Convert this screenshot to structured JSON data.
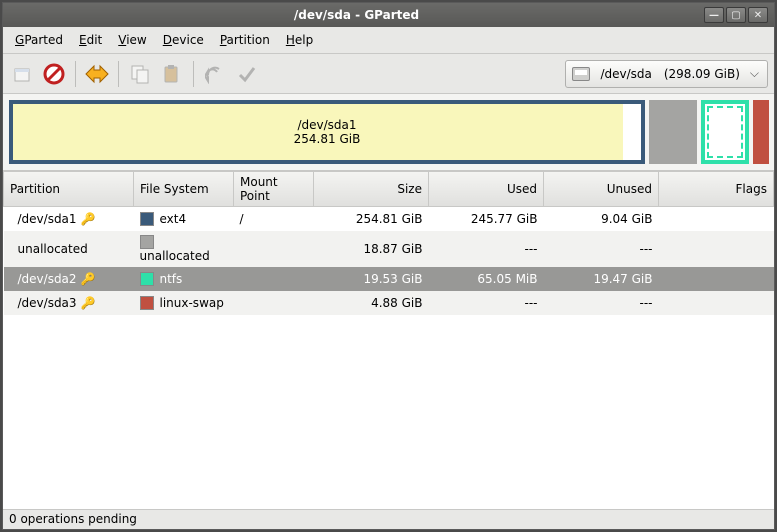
{
  "window": {
    "title": "/dev/sda - GParted"
  },
  "menubar": {
    "gparted": "GParted",
    "edit": "Edit",
    "view": "View",
    "device": "Device",
    "partition": "Partition",
    "help": "Help"
  },
  "toolbar": {
    "new": "New",
    "delete": "Delete",
    "resize": "Resize/Move",
    "copy": "Copy",
    "paste": "Paste",
    "undo": "Undo",
    "apply": "Apply"
  },
  "device": {
    "path": "/dev/sda",
    "size": "(298.09 GiB)"
  },
  "viz": {
    "main_label": "/dev/sda1",
    "main_size": "254.81 GiB"
  },
  "columns": {
    "partition": "Partition",
    "filesystem": "File System",
    "mountpoint": "Mount Point",
    "size": "Size",
    "used": "Used",
    "unused": "Unused",
    "flags": "Flags"
  },
  "rows": [
    {
      "name": "/dev/sda1",
      "locked": true,
      "fs": "ext4",
      "fs_color": "#3a5a7a",
      "mount": "/",
      "size": "254.81 GiB",
      "used": "245.77 GiB",
      "unused": "9.04 GiB",
      "flags": "",
      "selected": false,
      "striped": false
    },
    {
      "name": "unallocated",
      "locked": false,
      "fs": "unallocated",
      "fs_color": "#a4a4a2",
      "mount": "",
      "size": "18.87 GiB",
      "used": "---",
      "unused": "---",
      "flags": "",
      "selected": false,
      "striped": true
    },
    {
      "name": "/dev/sda2",
      "locked": true,
      "fs": "ntfs",
      "fs_color": "#2ee0a9",
      "mount": "",
      "size": "19.53 GiB",
      "used": "65.05 MiB",
      "unused": "19.47 GiB",
      "flags": "",
      "selected": true,
      "striped": false
    },
    {
      "name": "/dev/sda3",
      "locked": true,
      "fs": "linux-swap",
      "fs_color": "#c05040",
      "mount": "",
      "size": "4.88 GiB",
      "used": "---",
      "unused": "---",
      "flags": "",
      "selected": false,
      "striped": true
    }
  ],
  "statusbar": {
    "text": "0 operations pending"
  }
}
